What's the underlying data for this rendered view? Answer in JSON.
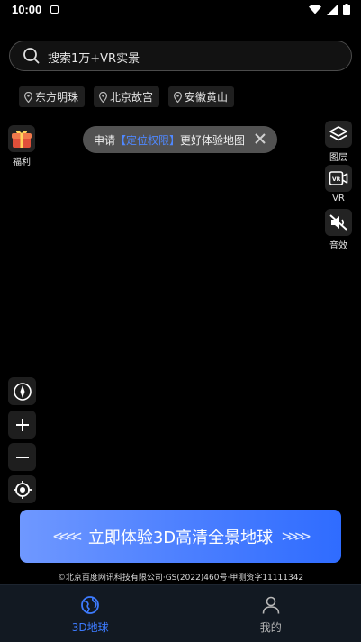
{
  "status": {
    "time": "10:00"
  },
  "search": {
    "placeholder": "搜索1万+VR实景"
  },
  "chips": [
    "东方明珠",
    "北京故宫",
    "安徽黄山"
  ],
  "left_tools": {
    "welfare_label": "福利"
  },
  "right_tools": {
    "layers_label": "图层",
    "vr_label": "VR",
    "sound_label": "音效"
  },
  "toast": {
    "prefix": "申请",
    "link": "【定位权限】",
    "suffix": "更好体验地图"
  },
  "cta": {
    "left_arrows": "<<<<",
    "label": "立即体验3D高清全景地球",
    "right_arrows": ">>>>"
  },
  "copyright": "©北京百度网讯科技有限公司·GS(2022)460号·甲测资字11111342",
  "nav": {
    "globe_label": "3D地球",
    "mine_label": "我的"
  },
  "colors": {
    "accent": "#3d7bff",
    "cta_start": "#6f98ff",
    "cta_end": "#2f6cff"
  }
}
